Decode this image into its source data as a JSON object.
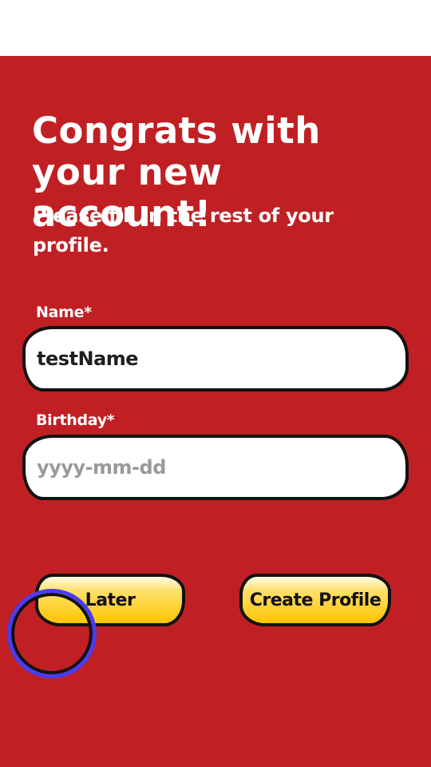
{
  "screen": {
    "headline": "Congrats with your new account!",
    "subline": "Please fill in the rest of your profile."
  },
  "form": {
    "name_label": "Name*",
    "name_value": "testName",
    "birthday_label": "Birthday*",
    "birthday_placeholder": "yyyy-mm-dd",
    "birthday_value": ""
  },
  "actions": {
    "later_label": "Later",
    "create_label": "Create Profile"
  },
  "colors": {
    "background": "#c02024",
    "button_fill": "#ffc400",
    "touch_indicator": "#4a3cf2"
  }
}
